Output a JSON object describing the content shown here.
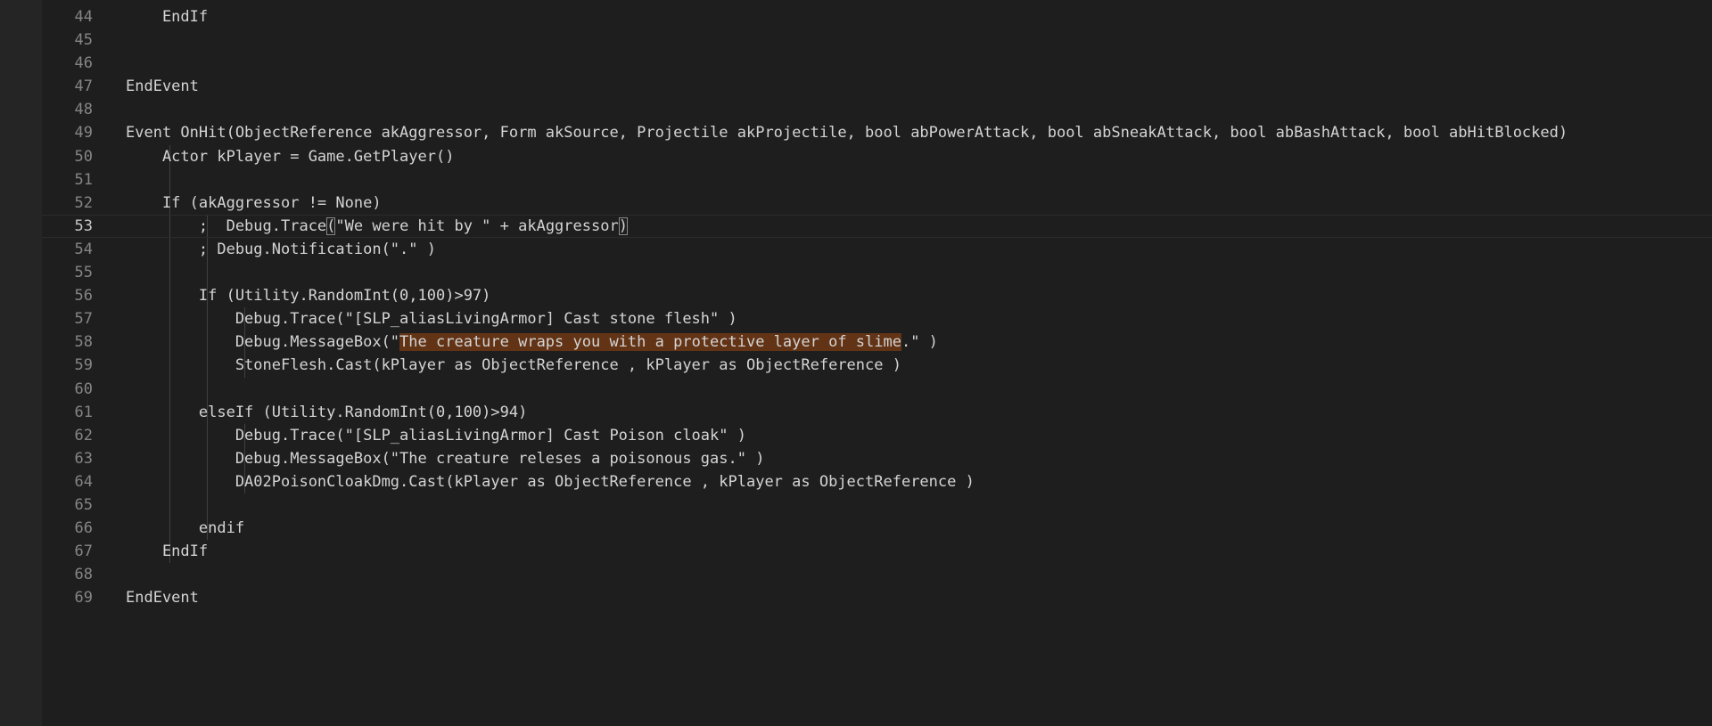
{
  "editor": {
    "lines": [
      {
        "n": "44",
        "pre": "    EndIf",
        "hl": "",
        "post": ""
      },
      {
        "n": "45",
        "pre": "",
        "hl": "",
        "post": ""
      },
      {
        "n": "46",
        "pre": "",
        "hl": "",
        "post": ""
      },
      {
        "n": "47",
        "pre": "EndEvent",
        "hl": "",
        "post": ""
      },
      {
        "n": "48",
        "pre": "",
        "hl": "",
        "post": ""
      },
      {
        "n": "49",
        "pre": "Event OnHit(ObjectReference akAggressor, Form akSource, Projectile akProjectile, bool abPowerAttack, bool abSneakAttack, bool abBashAttack, bool abHitBlocked)",
        "hl": "",
        "post": ""
      },
      {
        "n": "50",
        "pre": "    Actor kPlayer = Game.GetPlayer()",
        "hl": "",
        "post": ""
      },
      {
        "n": "51",
        "pre": "",
        "hl": "",
        "post": ""
      },
      {
        "n": "52",
        "pre": "    If (akAggressor != None)",
        "hl": "",
        "post": ""
      },
      {
        "n": "53",
        "pre": "        ;  Debug.Trace",
        "hl": "(",
        "post": "\"We were hit by \" + akAggressor",
        "hl2": ")"
      },
      {
        "n": "54",
        "pre": "        ; Debug.Notification(\".\" )",
        "hl": "",
        "post": ""
      },
      {
        "n": "55",
        "pre": "",
        "hl": "",
        "post": ""
      },
      {
        "n": "56",
        "pre": "        If (Utility.RandomInt(0,100)>97)",
        "hl": "",
        "post": ""
      },
      {
        "n": "57",
        "pre": "            Debug.Trace(\"[SLP_aliasLivingArmor] Cast stone flesh\" )",
        "hl": "",
        "post": ""
      },
      {
        "n": "58",
        "pre": "            Debug.MessageBox(\"",
        "hl": "The creature wraps you with a protective layer of slime",
        "post": ".\" )"
      },
      {
        "n": "59",
        "pre": "            StoneFlesh.Cast(kPlayer as ObjectReference , kPlayer as ObjectReference )",
        "hl": "",
        "post": ""
      },
      {
        "n": "60",
        "pre": "",
        "hl": "",
        "post": ""
      },
      {
        "n": "61",
        "pre": "        elseIf (Utility.RandomInt(0,100)>94)",
        "hl": "",
        "post": ""
      },
      {
        "n": "62",
        "pre": "            Debug.Trace(\"[SLP_aliasLivingArmor] Cast Poison cloak\" )",
        "hl": "",
        "post": ""
      },
      {
        "n": "63",
        "pre": "            Debug.MessageBox(\"The creature releses a poisonous gas.\" )",
        "hl": "",
        "post": ""
      },
      {
        "n": "64",
        "pre": "            DA02PoisonCloakDmg.Cast(kPlayer as ObjectReference , kPlayer as ObjectReference )",
        "hl": "",
        "post": ""
      },
      {
        "n": "65",
        "pre": "",
        "hl": "",
        "post": ""
      },
      {
        "n": "66",
        "pre": "        endif",
        "hl": "",
        "post": ""
      },
      {
        "n": "67",
        "pre": "    EndIf",
        "hl": "",
        "post": ""
      },
      {
        "n": "68",
        "pre": "",
        "hl": "",
        "post": ""
      },
      {
        "n": "69",
        "pre": "EndEvent",
        "hl": "",
        "post": ""
      }
    ],
    "current_line": "53",
    "colors": {
      "background": "#1e1e1e",
      "text": "#d4d4d4",
      "line_number": "#858585",
      "selection_highlight": "#623315"
    }
  }
}
